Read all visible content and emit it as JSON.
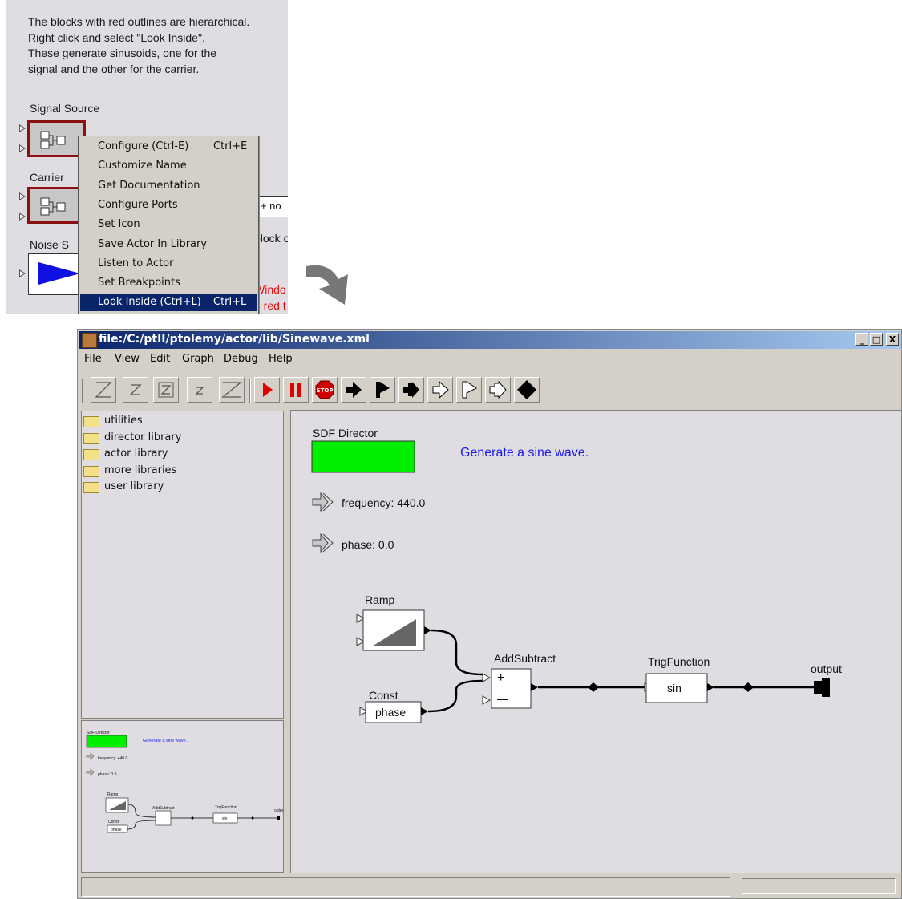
{
  "snippet": {
    "description_lines": [
      "The blocks with red outlines are hierarchical.",
      "Right click and select \"Look Inside\".",
      "These generate sinusoids, one for the",
      "signal and the other for the carrier."
    ],
    "signal_source_label": "Signal Source",
    "carrier_label": "Carrier",
    "noise_label": "Noise S",
    "bg_fragment_1": "r + no",
    "bg_fragment_2": "block c",
    "bg_fragment_3": "Windo",
    "bg_fragment_4": "e red t",
    "context_menu": {
      "items": [
        {
          "label": "Configure (Ctrl-E)",
          "accel": "Ctrl+E"
        },
        {
          "label": "Customize Name",
          "accel": ""
        },
        {
          "label": "Get Documentation",
          "accel": ""
        },
        {
          "label": "Configure Ports",
          "accel": ""
        },
        {
          "label": "Set Icon",
          "accel": ""
        },
        {
          "label": "Save Actor In Library",
          "accel": ""
        },
        {
          "label": "Listen to Actor",
          "accel": ""
        },
        {
          "label": "Set Breakpoints",
          "accel": ""
        },
        {
          "label": "Look Inside (Ctrl+L)",
          "accel": "Ctrl+L"
        }
      ],
      "selected": "Look Inside (Ctrl+L)"
    }
  },
  "window": {
    "title": "file:/C:/ptII/ptolemy/actor/lib/Sinewave.xml",
    "controls": {
      "minimize": "_",
      "maximize": "□",
      "close": "X"
    },
    "menu": [
      "File",
      "View",
      "Edit",
      "Graph",
      "Debug",
      "Help"
    ],
    "toolbar": {
      "zoom_icons": [
        "zoom-reset",
        "zoom-in",
        "zoom-fit",
        "zoom-out",
        "zoom-full"
      ],
      "run_icons": [
        "run",
        "pause",
        "stop",
        "step-forward",
        "step-flag",
        "step-arrow-block",
        "outline-forward",
        "outline-flag",
        "outline-arrow",
        "diamond"
      ],
      "stop_text": "STOP"
    },
    "library": {
      "items": [
        "utilities",
        "director library",
        "actor library",
        "more libraries",
        "user library"
      ]
    },
    "canvas": {
      "director_label": "SDF Director",
      "annotation": "Generate a sine wave.",
      "params": [
        "frequency: 440.0",
        "phase: 0.0"
      ],
      "actors": {
        "ramp": "Ramp",
        "const": "Const",
        "const_value": "phase",
        "addsubtract": "AddSubtract",
        "plus": "+",
        "minus": "—",
        "trig": "TrigFunction",
        "trig_value": "sin",
        "output": "output"
      }
    },
    "overview": {
      "director_label": "SDF Director",
      "annotation": "Generate a sine wave.",
      "params": [
        "frequency: 440.0",
        "phase: 0.0"
      ],
      "ramp": "Ramp",
      "const": "Const",
      "const_value": "phase",
      "addsubtract": "AddSubtract",
      "trig": "TrigFunction",
      "trig_value": "sin",
      "output": "output"
    }
  },
  "colors": {
    "director_fill": "#00ee00",
    "annotation": "#1a1af0",
    "hier_border": "#8b1010",
    "noise_fill": "#1010e0",
    "selection": "#0a246a",
    "canvas_bg": "#e0dde2"
  }
}
